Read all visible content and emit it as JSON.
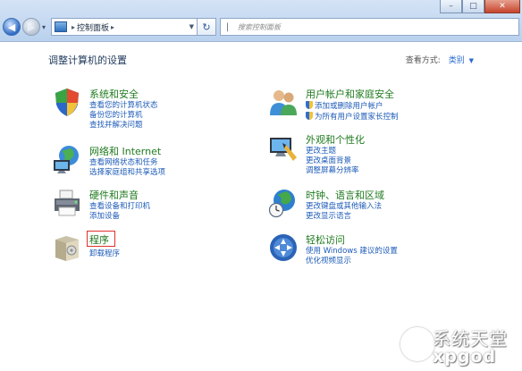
{
  "window": {
    "controls": {
      "minimize": "–",
      "maximize": "□",
      "close": "✕"
    }
  },
  "nav": {
    "back_icon": "back-arrow-icon",
    "forward_icon": "forward-arrow-icon",
    "breadcrumb": [
      "控制面板"
    ],
    "search_placeholder": "搜索控制面板",
    "refresh_icon": "refresh-icon"
  },
  "page": {
    "title": "调整计算机的设置",
    "view_by_label": "查看方式:",
    "view_by_value": "类别"
  },
  "categories": [
    {
      "title": "系统和安全",
      "icon": "system-security-shield-icon",
      "links": [
        "查看您的计算机状态",
        "备份您的计算机",
        "查找并解决问题"
      ]
    },
    {
      "title": "网络和 Internet",
      "icon": "network-globe-icon",
      "links": [
        "查看网络状态和任务",
        "选择家庭组和共享选项"
      ]
    },
    {
      "title": "硬件和声音",
      "icon": "printer-hardware-icon",
      "links": [
        "查看设备和打印机",
        "添加设备"
      ]
    },
    {
      "title": "程序",
      "icon": "programs-box-icon",
      "links": [
        "卸载程序"
      ]
    },
    {
      "title": "用户帐户和家庭安全",
      "icon": "users-icon",
      "links": [
        "添加或删除用户帐户",
        "为所有用户设置家长控制"
      ]
    },
    {
      "title": "外观和个性化",
      "icon": "monitor-personalize-icon",
      "links": [
        "更改主题",
        "更改桌面背景",
        "调整屏幕分辨率"
      ]
    },
    {
      "title": "时钟、语言和区域",
      "icon": "clock-globe-icon",
      "links": [
        "更改键盘或其他输入法",
        "更改显示语言"
      ]
    },
    {
      "title": "轻松访问",
      "icon": "ease-of-access-icon",
      "links": [
        "使用 Windows 建议的设置",
        "优化视频显示"
      ]
    }
  ],
  "watermark": {
    "brand": "系统天堂",
    "domain": "xpgod"
  }
}
